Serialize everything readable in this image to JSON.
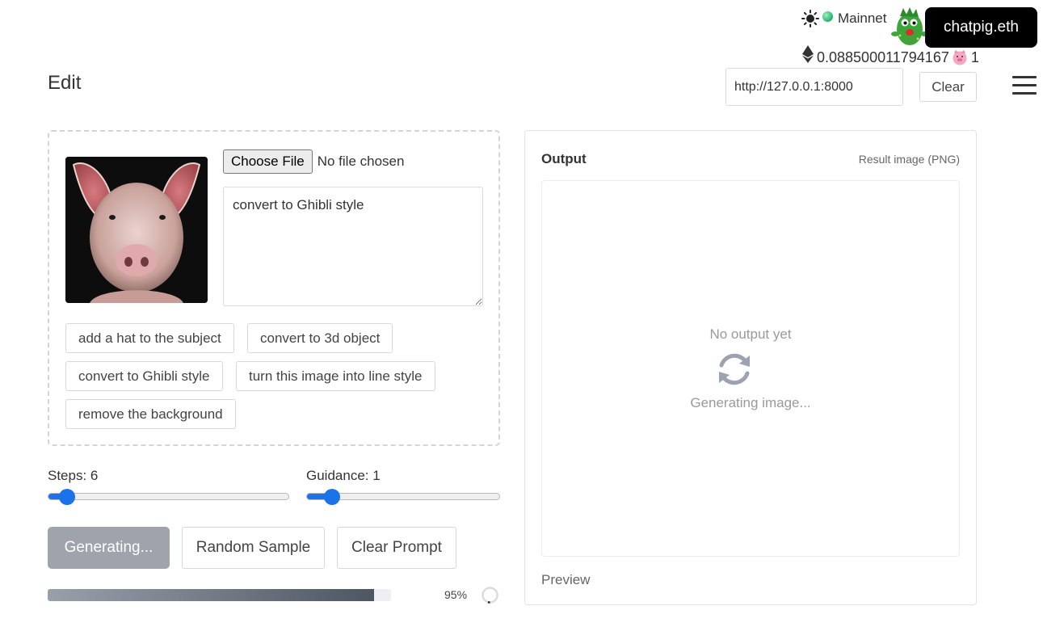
{
  "header": {
    "theme_icon": "sun-icon",
    "network_label": "Mainnet",
    "network_color": "#23b26a",
    "account_name": "chatpig.eth",
    "eth_icon": "ethereum-icon",
    "eth_balance": "0.088500011794167",
    "pig_icon": "pig-icon",
    "pig_count": "1",
    "menu_icon": "hamburger-menu-icon"
  },
  "page": {
    "title": "Edit"
  },
  "server": {
    "url_value": "http://127.0.0.1:8000",
    "clear_label": "Clear"
  },
  "editor": {
    "choose_file_label": "Choose File",
    "file_status": "No file chosen",
    "prompt_value": "convert to Ghibli style",
    "suggestions": [
      "add a hat to the subject",
      "convert to 3d object",
      "convert to Ghibli style",
      "turn this image into line style",
      "remove the background"
    ]
  },
  "controls": {
    "steps_label": "Steps: 6",
    "steps_value": 6,
    "guidance_label": "Guidance: 1",
    "guidance_value": 1,
    "generate_label": "Generating...",
    "random_label": "Random Sample",
    "clear_prompt_label": "Clear Prompt",
    "progress_percent": 95,
    "progress_text": "95%"
  },
  "output": {
    "title": "Output",
    "subtitle": "Result image (PNG)",
    "empty_text": "No output yet",
    "status_text": "Generating image...",
    "preview_label": "Preview",
    "accent_color": "#1a73e8"
  }
}
